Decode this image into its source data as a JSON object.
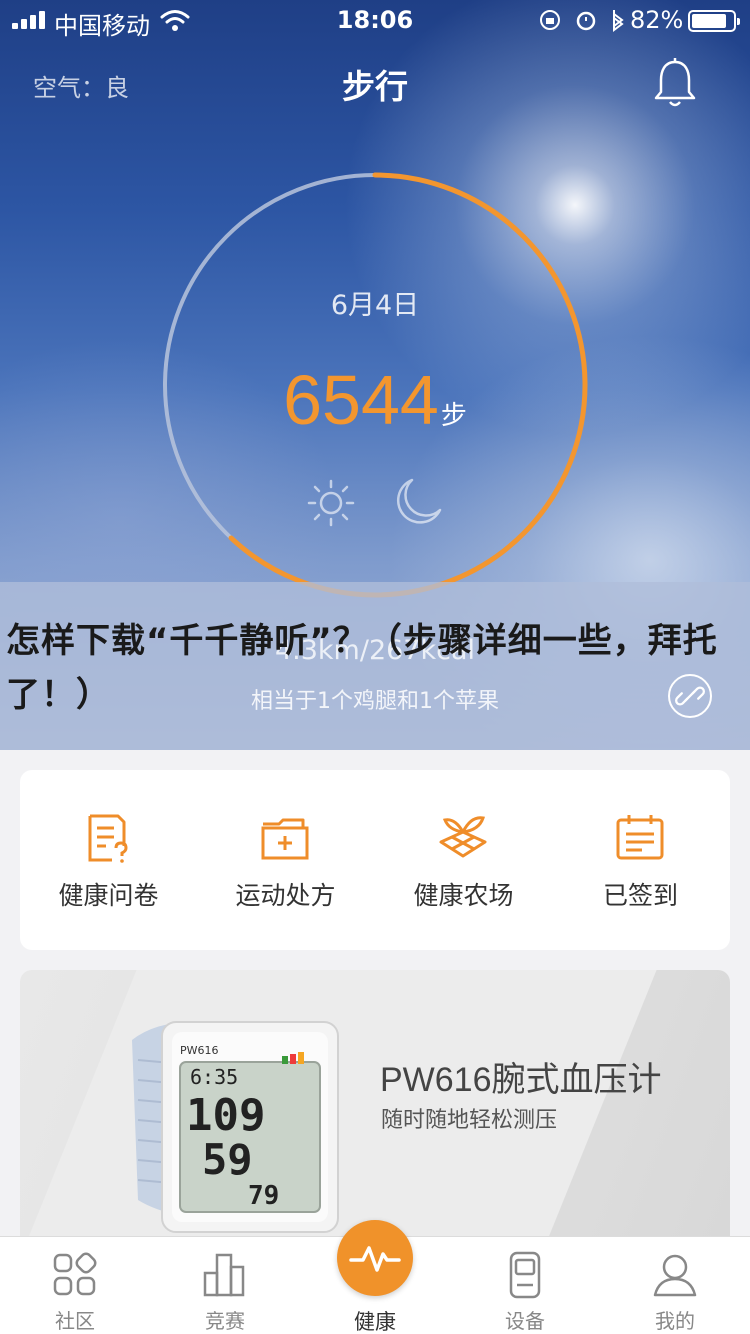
{
  "status_bar": {
    "carrier": "中国移动",
    "time": "18:06",
    "battery": "82%"
  },
  "header": {
    "air_quality": "空气：良",
    "title": "步行"
  },
  "ring": {
    "date": "6月4日",
    "steps": "6544",
    "unit": "步",
    "progress": 0.62
  },
  "summary": {
    "distance": "4.3km/267kcal",
    "equivalent": "相当于1个鸡腿和1个苹果"
  },
  "overlay": {
    "question": "怎样下载“千千静听”？（步骤详细一些，拜托了！）"
  },
  "quick_menu": [
    {
      "label": "健康问卷",
      "icon": "questionnaire-icon"
    },
    {
      "label": "运动处方",
      "icon": "prescription-folder-icon"
    },
    {
      "label": "健康农场",
      "icon": "farm-gift-icon"
    },
    {
      "label": "已签到",
      "icon": "calendar-checkin-icon"
    }
  ],
  "banner": {
    "product_name": "PW616腕式血压计",
    "product_desc": "随时随地轻松测压",
    "device": {
      "model": "PW616",
      "time": "6:35",
      "sys": "109",
      "dia": "59",
      "pulse": "79"
    }
  },
  "tabbar": [
    {
      "label": "社区",
      "icon": "community-icon"
    },
    {
      "label": "竞赛",
      "icon": "competition-icon"
    },
    {
      "label": "健康",
      "icon": "health-pulse-icon"
    },
    {
      "label": "设备",
      "icon": "device-icon"
    },
    {
      "label": "我的",
      "icon": "profile-icon"
    }
  ],
  "colors": {
    "accent": "#f3962f",
    "ring_track": "#b9c4dc"
  }
}
